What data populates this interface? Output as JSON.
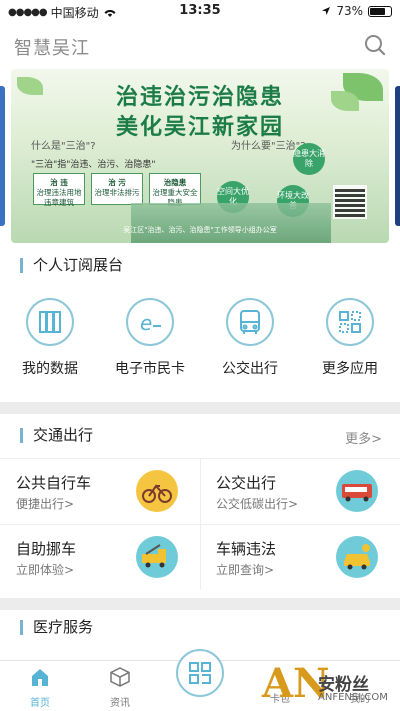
{
  "status_bar": {
    "carrier": "中国移动",
    "time": "13:35",
    "battery": "73%"
  },
  "header": {
    "title": "智慧吴江"
  },
  "banner": {
    "line1": "治违治污治隐患",
    "line2": "美化吴江新家园",
    "question_left": "什么是\"三治\"?",
    "question_right": "为什么要\"三治\"?",
    "description": "\"三治\"指\"治违、治污、治隐患\"",
    "boxes": [
      {
        "head": "治 违",
        "body": "治理违法用地违章建筑"
      },
      {
        "head": "治 污",
        "body": "治理非法排污"
      },
      {
        "head": "治隐患",
        "body": "治理重大安全隐患"
      }
    ],
    "circles": [
      "空间大优化",
      "隐患大消除",
      "环境大改善"
    ],
    "footer": "吴江区\"治违、治污、治隐患\"工作领导小组办公室"
  },
  "subscription": {
    "title": "个人订阅展台",
    "items": [
      {
        "label": "我的数据",
        "icon": "my-data-icon"
      },
      {
        "label": "电子市民卡",
        "icon": "e-citizen-card-icon"
      },
      {
        "label": "公交出行",
        "icon": "bus-icon"
      },
      {
        "label": "更多应用",
        "icon": "more-apps-icon"
      }
    ]
  },
  "traffic": {
    "title": "交通出行",
    "more": "更多>",
    "cells": [
      {
        "title": "公共自行车",
        "sub": "便捷出行>",
        "icon": "bicycle-icon",
        "bg": "#f5c542"
      },
      {
        "title": "公交出行",
        "sub": "公交低碳出行>",
        "icon": "bus-photo-icon",
        "bg": "#6fcbd8"
      },
      {
        "title": "自助挪车",
        "sub": "立即体验>",
        "icon": "tow-truck-icon",
        "bg": "#6fcbd8"
      },
      {
        "title": "车辆违法",
        "sub": "立即查询>",
        "icon": "taxi-icon",
        "bg": "#6fcbd8"
      }
    ]
  },
  "medical": {
    "title": "医疗服务"
  },
  "tabbar": {
    "tabs": [
      {
        "label": "首页",
        "icon": "home-icon",
        "active": true
      },
      {
        "label": "资讯",
        "icon": "cube-icon",
        "active": false
      },
      {
        "label": "卡包",
        "icon": "card-icon",
        "active": false
      },
      {
        "label": "我的",
        "icon": "profile-icon",
        "active": false
      }
    ],
    "scan_icon": "qr-scan-icon"
  },
  "watermark": {
    "letters": "AN",
    "cn": "安粉丝",
    "en": "ANFENSI.COM"
  },
  "colors": {
    "accent": "#58b4d4",
    "section_bar": "#7ab3cf",
    "banner_green": "#1c7c48",
    "watermark_gold": "#d89a1c"
  }
}
